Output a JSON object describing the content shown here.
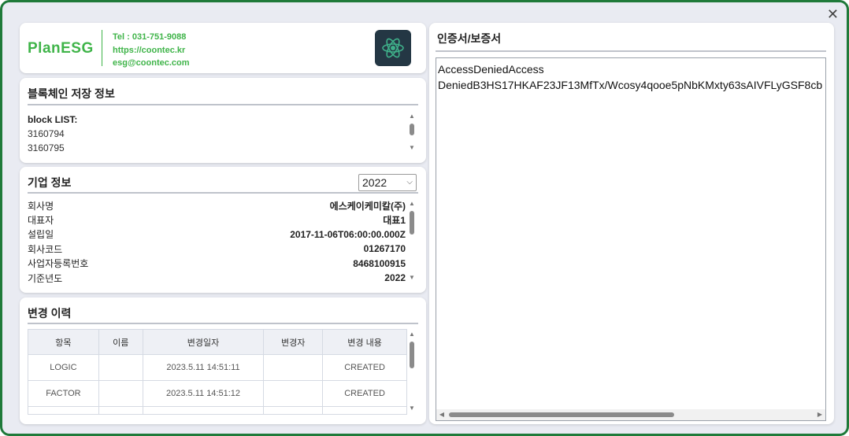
{
  "window": {
    "close_glyph": "✕"
  },
  "header": {
    "logo_text": "PlanESG",
    "contact": {
      "tel": "Tel : 031-751-9088",
      "web": "https://coontec.kr",
      "email": "esg@coontec.com"
    },
    "app_icon": "atom-icon",
    "brand_color": "#3fb449"
  },
  "blockchain": {
    "title": "블록체인 저장 정보",
    "list_header": "block LIST:",
    "items": [
      "3160794",
      "3160795"
    ]
  },
  "company": {
    "title": "기업 정보",
    "year_selected": "2022",
    "fields": [
      {
        "label": "회사명",
        "value": "에스케이케미칼(주)"
      },
      {
        "label": "대표자",
        "value": "대표1"
      },
      {
        "label": "설립일",
        "value": "2017-11-06T06:00:00.000Z"
      },
      {
        "label": "회사코드",
        "value": "01267170"
      },
      {
        "label": "사업자등록번호",
        "value": "8468100915"
      },
      {
        "label": "기준년도",
        "value": "2022"
      }
    ]
  },
  "history": {
    "title": "변경 이력",
    "columns": [
      "항목",
      "이름",
      "변경일자",
      "변경자",
      "변경 내용"
    ],
    "rows": [
      [
        "LOGIC",
        "",
        "2023.5.11 14:51:11",
        "",
        "CREATED"
      ],
      [
        "FACTOR",
        "",
        "2023.5.11 14:51:12",
        "",
        "CREATED"
      ]
    ]
  },
  "certificate": {
    "title": "인증서/보증서",
    "content": "AccessDeniedAccess\nDeniedB3HS17HKAF23JF13MfTx/Wcosy4qooe5pNbKMxty63sAIVFLyGSF8cb"
  }
}
